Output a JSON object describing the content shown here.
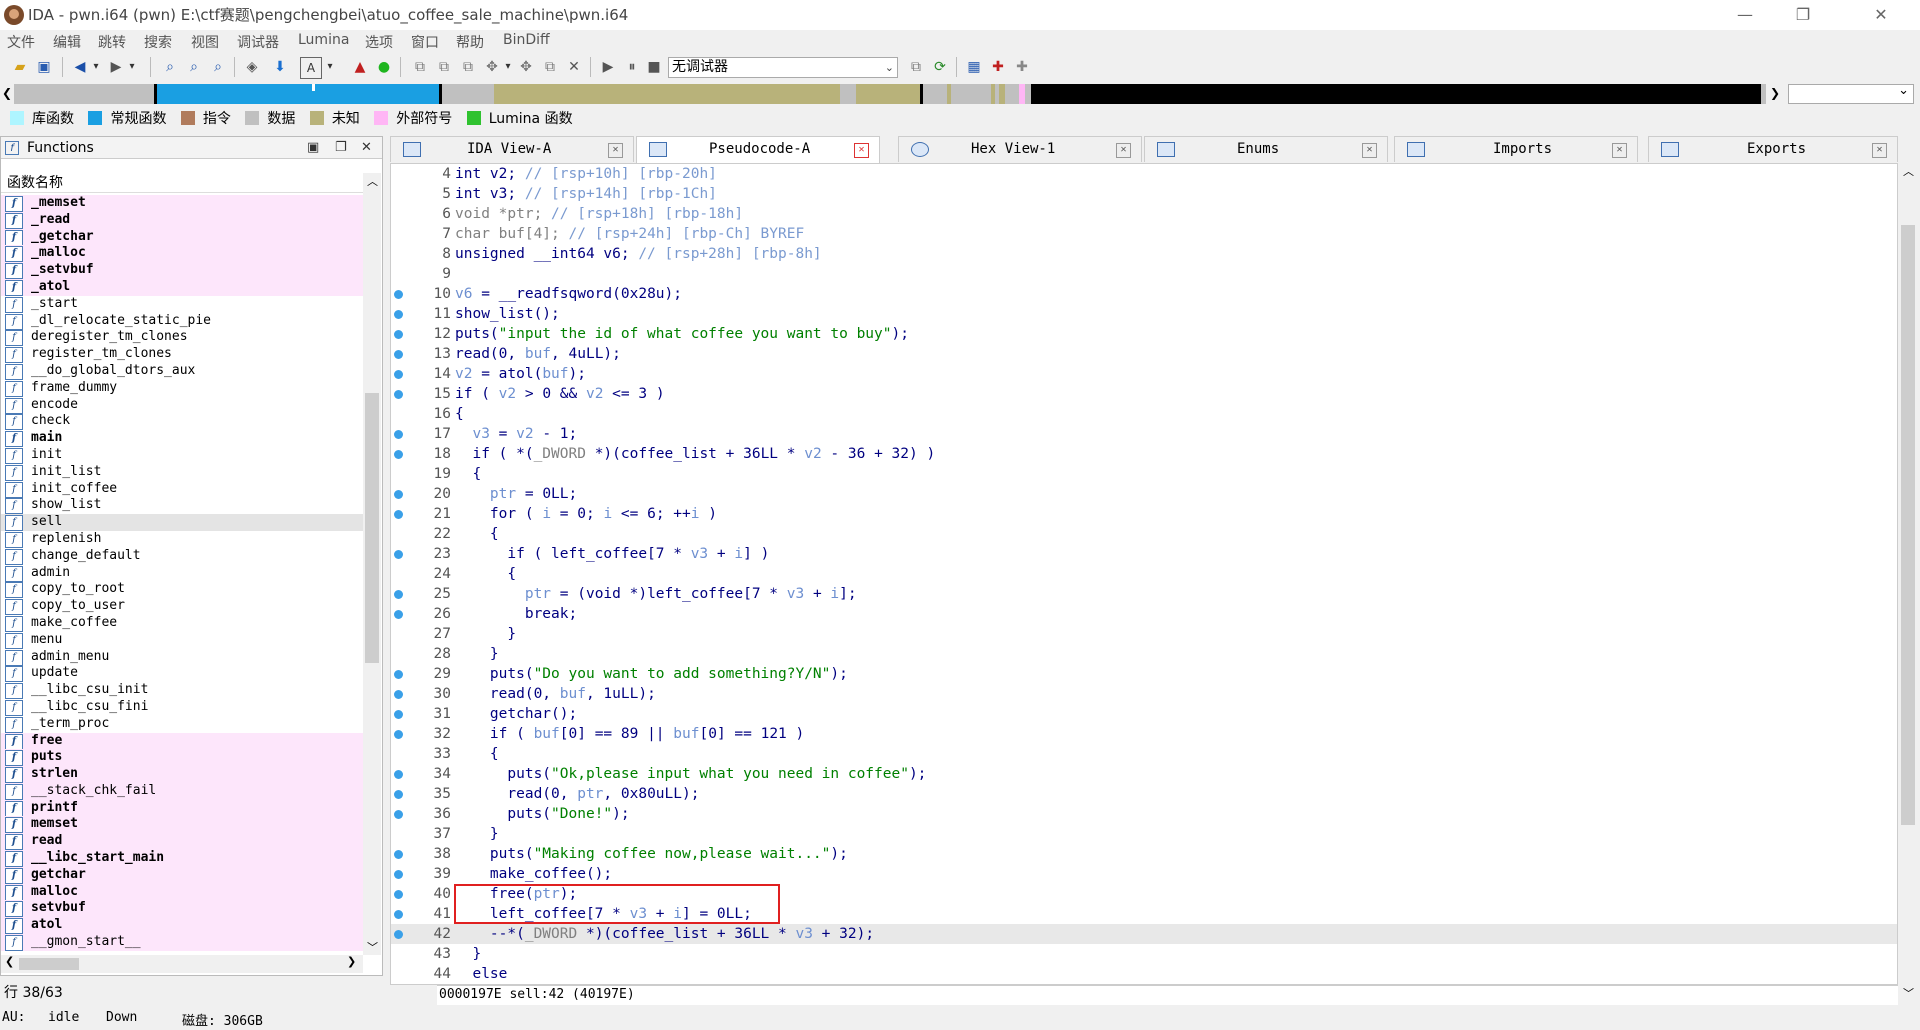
{
  "window": {
    "title": "IDA - pwn.i64 (pwn) E:\\ctf赛题\\pengchengbei\\atuo_coffee_sale_machine\\pwn.i64",
    "minimize": "—",
    "maximize": "❐",
    "close": "✕"
  },
  "menu": [
    "文件",
    "编辑",
    "跳转",
    "搜索",
    "视图",
    "调试器",
    "Lumina",
    "选项",
    "窗口",
    "帮助",
    "BinDiff"
  ],
  "toolbar": {
    "debugger_label": "无调试器"
  },
  "legend": [
    {
      "label": "库函数",
      "color": "#aef5ff"
    },
    {
      "label": "常规函数",
      "color": "#1a9fe2"
    },
    {
      "label": "指令",
      "color": "#b07b5c"
    },
    {
      "label": "数据",
      "color": "#c0c0c0"
    },
    {
      "label": "未知",
      "color": "#b8b27a"
    },
    {
      "label": "外部符号",
      "color": "#ffb6f5"
    },
    {
      "label": "Lumina 函数",
      "color": "#2fc22f"
    }
  ],
  "functions_panel": {
    "title": "Functions",
    "column_header": "函数名称",
    "status": "行 38/63",
    "items": [
      {
        "name": "_memset",
        "style": "lib"
      },
      {
        "name": "_read",
        "style": "lib"
      },
      {
        "name": "_getchar",
        "style": "lib"
      },
      {
        "name": "_malloc",
        "style": "lib"
      },
      {
        "name": "_setvbuf",
        "style": "lib"
      },
      {
        "name": "_atol",
        "style": "lib"
      },
      {
        "name": "_start",
        "style": ""
      },
      {
        "name": "_dl_relocate_static_pie",
        "style": ""
      },
      {
        "name": "deregister_tm_clones",
        "style": ""
      },
      {
        "name": "register_tm_clones",
        "style": ""
      },
      {
        "name": "__do_global_dtors_aux",
        "style": ""
      },
      {
        "name": "frame_dummy",
        "style": ""
      },
      {
        "name": "encode",
        "style": ""
      },
      {
        "name": "check",
        "style": ""
      },
      {
        "name": "main",
        "style": "bold"
      },
      {
        "name": "init",
        "style": ""
      },
      {
        "name": "init_list",
        "style": ""
      },
      {
        "name": "init_coffee",
        "style": ""
      },
      {
        "name": "show_list",
        "style": ""
      },
      {
        "name": "sell",
        "style": "sel"
      },
      {
        "name": "replenish",
        "style": ""
      },
      {
        "name": "change_default",
        "style": ""
      },
      {
        "name": "admin",
        "style": ""
      },
      {
        "name": "copy_to_root",
        "style": ""
      },
      {
        "name": "copy_to_user",
        "style": ""
      },
      {
        "name": "make_coffee",
        "style": ""
      },
      {
        "name": "menu",
        "style": ""
      },
      {
        "name": "admin_menu",
        "style": ""
      },
      {
        "name": "update",
        "style": ""
      },
      {
        "name": "__libc_csu_init",
        "style": ""
      },
      {
        "name": "__libc_csu_fini",
        "style": ""
      },
      {
        "name": "_term_proc",
        "style": ""
      },
      {
        "name": "free",
        "style": "ext"
      },
      {
        "name": "puts",
        "style": "ext"
      },
      {
        "name": "strlen",
        "style": "ext"
      },
      {
        "name": "__stack_chk_fail",
        "style": "ext-normal"
      },
      {
        "name": "printf",
        "style": "ext"
      },
      {
        "name": "memset",
        "style": "ext"
      },
      {
        "name": "read",
        "style": "ext"
      },
      {
        "name": "__libc_start_main",
        "style": "ext"
      },
      {
        "name": "getchar",
        "style": "ext"
      },
      {
        "name": "malloc",
        "style": "ext"
      },
      {
        "name": "setvbuf",
        "style": "ext"
      },
      {
        "name": "atol",
        "style": "ext"
      },
      {
        "name": "__gmon_start__",
        "style": "ext-normal"
      }
    ]
  },
  "tabs": [
    {
      "label": "IDA View-A",
      "active": false
    },
    {
      "label": "Pseudocode-A",
      "active": true
    },
    {
      "label": "Hex View-1",
      "active": false
    },
    {
      "label": "Enums",
      "active": false
    },
    {
      "label": "Imports",
      "active": false
    },
    {
      "label": "Exports",
      "active": false
    }
  ],
  "code": {
    "status": "0000197E sell:42 (40197E)",
    "lines": [
      {
        "n": "4",
        "bp": false,
        "html": "int v2; <span class='c-cmt'>// [rsp+10h] [rbp-20h]</span>"
      },
      {
        "n": "5",
        "bp": false,
        "html": "int v3; <span class='c-cmt'>// [rsp+14h] [rbp-1Ch]</span>"
      },
      {
        "n": "6",
        "bp": false,
        "html": "<span class='c-gray'>void *ptr; </span><span class='c-cmt'>// [rsp+18h] [rbp-18h]</span>"
      },
      {
        "n": "7",
        "bp": false,
        "html": "<span class='c-gray'>char buf[4]; </span><span class='c-cmt'>// [rsp+24h] [rbp-Ch] BYREF</span>"
      },
      {
        "n": "8",
        "bp": false,
        "html": "unsigned __int64 v6; <span class='c-cmt'>// [rsp+28h] [rbp-8h]</span>"
      },
      {
        "n": "9",
        "bp": false,
        "html": ""
      },
      {
        "n": "10",
        "bp": true,
        "html": "<span class='c-var'>v6</span> = __readfsqword(0x28u);"
      },
      {
        "n": "11",
        "bp": true,
        "html": "show_list();"
      },
      {
        "n": "12",
        "bp": true,
        "html": "puts(<span class='c-str'>\"input the id of what coffee you want to buy\"</span>);"
      },
      {
        "n": "13",
        "bp": true,
        "html": "read(0, <span class='c-var'>buf</span>, 4uLL);"
      },
      {
        "n": "14",
        "bp": true,
        "html": "<span class='c-var'>v2</span> = atol(<span class='c-var'>buf</span>);"
      },
      {
        "n": "15",
        "bp": true,
        "html": "if ( <span class='c-var'>v2</span> &gt; 0 &amp;&amp; <span class='c-var'>v2</span> &lt;= 3 )"
      },
      {
        "n": "16",
        "bp": false,
        "html": "{"
      },
      {
        "n": "17",
        "bp": true,
        "html": "  <span class='c-var'>v3</span> = <span class='c-var'>v2</span> - 1;"
      },
      {
        "n": "18",
        "bp": true,
        "html": "  if ( *(<span class='c-gray'>_DWORD</span> *)(coffee_list + 36LL * <span class='c-var'>v2</span> - 36 + 32) )"
      },
      {
        "n": "19",
        "bp": false,
        "html": "  {"
      },
      {
        "n": "20",
        "bp": true,
        "html": "    <span class='c-var'>ptr</span> = 0LL;"
      },
      {
        "n": "21",
        "bp": true,
        "html": "    for ( <span class='c-var'>i</span> = 0; <span class='c-var'>i</span> &lt;= 6; ++<span class='c-var'>i</span> )"
      },
      {
        "n": "22",
        "bp": false,
        "html": "    {"
      },
      {
        "n": "23",
        "bp": true,
        "html": "      if ( left_coffee[7 * <span class='c-var'>v3</span> + <span class='c-var'>i</span>] )"
      },
      {
        "n": "24",
        "bp": false,
        "html": "      {"
      },
      {
        "n": "25",
        "bp": true,
        "html": "        <span class='c-var'>ptr</span> = (void *)left_coffee[7 * <span class='c-var'>v3</span> + <span class='c-var'>i</span>];"
      },
      {
        "n": "26",
        "bp": true,
        "html": "        break;"
      },
      {
        "n": "27",
        "bp": false,
        "html": "      }"
      },
      {
        "n": "28",
        "bp": false,
        "html": "    }"
      },
      {
        "n": "29",
        "bp": true,
        "html": "    puts(<span class='c-str'>\"Do you want to add something?Y/N\"</span>);"
      },
      {
        "n": "30",
        "bp": true,
        "html": "    read(0, <span class='c-var'>buf</span>, 1uLL);"
      },
      {
        "n": "31",
        "bp": true,
        "html": "    getchar();"
      },
      {
        "n": "32",
        "bp": true,
        "html": "    if ( <span class='c-var'>buf</span>[0] == 89 || <span class='c-var'>buf</span>[0] == 121 )"
      },
      {
        "n": "33",
        "bp": false,
        "html": "    {"
      },
      {
        "n": "34",
        "bp": true,
        "html": "      puts(<span class='c-str'>\"Ok,please input what you need in coffee\"</span>);"
      },
      {
        "n": "35",
        "bp": true,
        "html": "      read(0, <span class='c-var'>ptr</span>, 0x80uLL);"
      },
      {
        "n": "36",
        "bp": true,
        "html": "      puts(<span class='c-str'>\"Done!\"</span>);"
      },
      {
        "n": "37",
        "bp": false,
        "html": "    }"
      },
      {
        "n": "38",
        "bp": true,
        "html": "    puts(<span class='c-str'>\"Making coffee now,please wait...\"</span>);"
      },
      {
        "n": "39",
        "bp": true,
        "html": "    make_coffee();"
      },
      {
        "n": "40",
        "bp": true,
        "html": "    free(<span class='c-var'>ptr</span>);"
      },
      {
        "n": "41",
        "bp": true,
        "html": "    left_coffee[7 * <span class='c-var'>v3</span> + <span class='c-var'>i</span>] = 0LL;"
      },
      {
        "n": "42",
        "bp": true,
        "html": "    --*(<span class='c-gray'>_DWORD</span> *)(coffee_list + 36LL * <span class='c-var'>v3</span> + 32);",
        "hl": true
      },
      {
        "n": "43",
        "bp": false,
        "html": "  }"
      },
      {
        "n": "44",
        "bp": false,
        "html": "  else"
      }
    ]
  },
  "status": {
    "au": "AU:",
    "state": "idle",
    "direction": "Down",
    "disk": "磁盘: 306GB"
  }
}
